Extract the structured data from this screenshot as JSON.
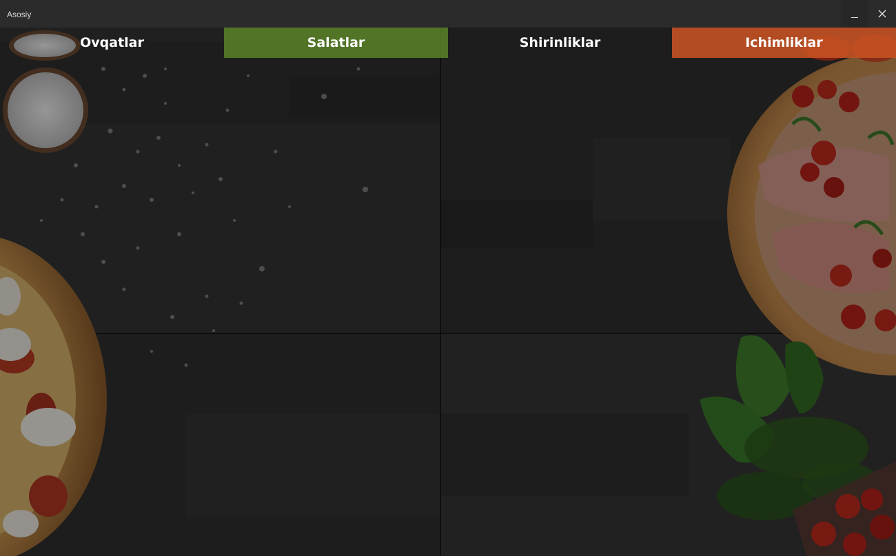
{
  "window": {
    "title": "Asosiy",
    "minimize_glyph": "_",
    "close_glyph": "✕"
  },
  "nav": {
    "tabs": [
      {
        "label": "Ovqatlar"
      },
      {
        "label": "Salatlar"
      },
      {
        "label": "Shirinliklar"
      },
      {
        "label": "Ichimliklar"
      }
    ]
  },
  "colors": {
    "titlebar": "#2b2b2b",
    "salatlar_tab": "#588028",
    "ichimliklar_tab": "#c45223",
    "background": "#333333"
  },
  "icons": [
    "minimize-icon",
    "close-icon"
  ]
}
